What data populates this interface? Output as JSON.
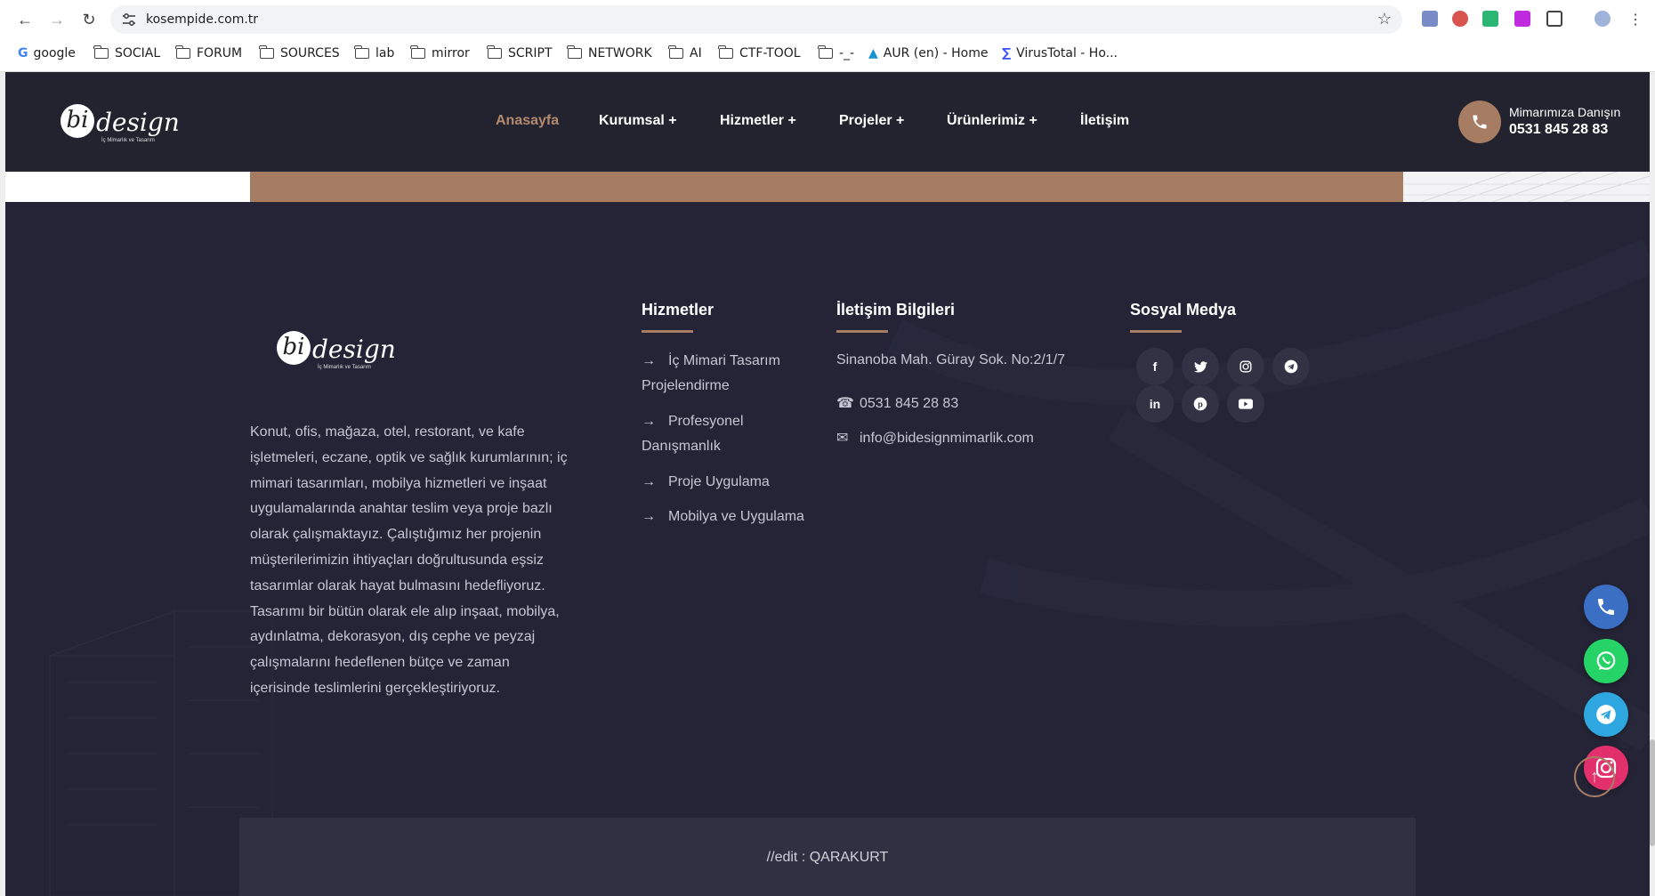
{
  "browser": {
    "url": "kosempide.com.tr",
    "bookmarks": [
      {
        "label": "google",
        "type": "google"
      },
      {
        "label": "SOCIAL",
        "type": "folder"
      },
      {
        "label": "FORUM",
        "type": "folder"
      },
      {
        "label": "SOURCES",
        "type": "folder"
      },
      {
        "label": "lab",
        "type": "folder"
      },
      {
        "label": "mirror",
        "type": "folder"
      },
      {
        "label": "SCRIPT",
        "type": "folder"
      },
      {
        "label": "NETWORK",
        "type": "folder"
      },
      {
        "label": "AI",
        "type": "folder"
      },
      {
        "label": "CTF-TOOL",
        "type": "folder"
      },
      {
        "label": "-_-",
        "type": "folder"
      },
      {
        "label": "AUR (en) - Home",
        "type": "site"
      },
      {
        "label": "VirusTotal - Ho...",
        "type": "site"
      }
    ]
  },
  "header": {
    "logo_letters": "bi",
    "logo_word": "design",
    "logo_tagline": "İç Mimarlık ve Tasarım",
    "menu": [
      {
        "label": "Anasayfa",
        "active": true
      },
      {
        "label": "Kurumsal +",
        "active": false
      },
      {
        "label": "Hizmetler +",
        "active": false
      },
      {
        "label": "Projeler +",
        "active": false
      },
      {
        "label": "Ürünlerimiz +",
        "active": false
      },
      {
        "label": "İletişim",
        "active": false
      }
    ],
    "cta_small": "Mimarımıza Danışın",
    "cta_phone": "0531 845 28 83"
  },
  "footer": {
    "about": "Konut, ofis, mağaza, otel, restorant, ve kafe işletmeleri, eczane, optik ve sağlık kurumlarının; iç mimari tasarımları, mobilya hizmetleri ve inşaat uygulamalarında anahtar teslim veya proje bazlı olarak çalışmaktayız. Çalıştığımız her projenin müşterilerimizin ihtiyaçları doğrultusunda eşsiz tasarımlar olarak hayat bulmasını hedefliyoruz. Tasarımı bir bütün olarak ele alıp inşaat, mobilya, aydınlatma, dekorasyon, dış cephe ve peyzaj çalışmalarını hedeflenen bütçe ve zaman içerisinde teslimlerini gerçekleştiriyoruz.",
    "services_title": "Hizmetler",
    "services": [
      "İç Mimari Tasarım Projelendirme",
      "Profesyonel Danışmanlık",
      "Proje Uygulama",
      "Mobilya ve Uygulama"
    ],
    "contact_title": "İletişim Bilgileri",
    "address": "Sinanoba Mah. Güray Sok. No:2/1/7",
    "phone": "0531 845 28 83",
    "email": "info@bidesignmimarlik.com",
    "social_title": "Sosyal Medya",
    "social": [
      "facebook",
      "twitter",
      "instagram",
      "telegram",
      "linkedin",
      "pinterest",
      "youtube"
    ],
    "copyright": "//edit : QARAKURT"
  },
  "floating": [
    "phone",
    "whatsapp",
    "telegram",
    "instagram"
  ],
  "colors": {
    "accent": "#a67c63",
    "page_bg": "#252437",
    "header_bg": "#23222f",
    "phone_btn": "#3b6fc4",
    "whatsapp_btn": "#25d366",
    "telegram_btn": "#2ea6e0",
    "instagram_btn": "#e1306c"
  }
}
